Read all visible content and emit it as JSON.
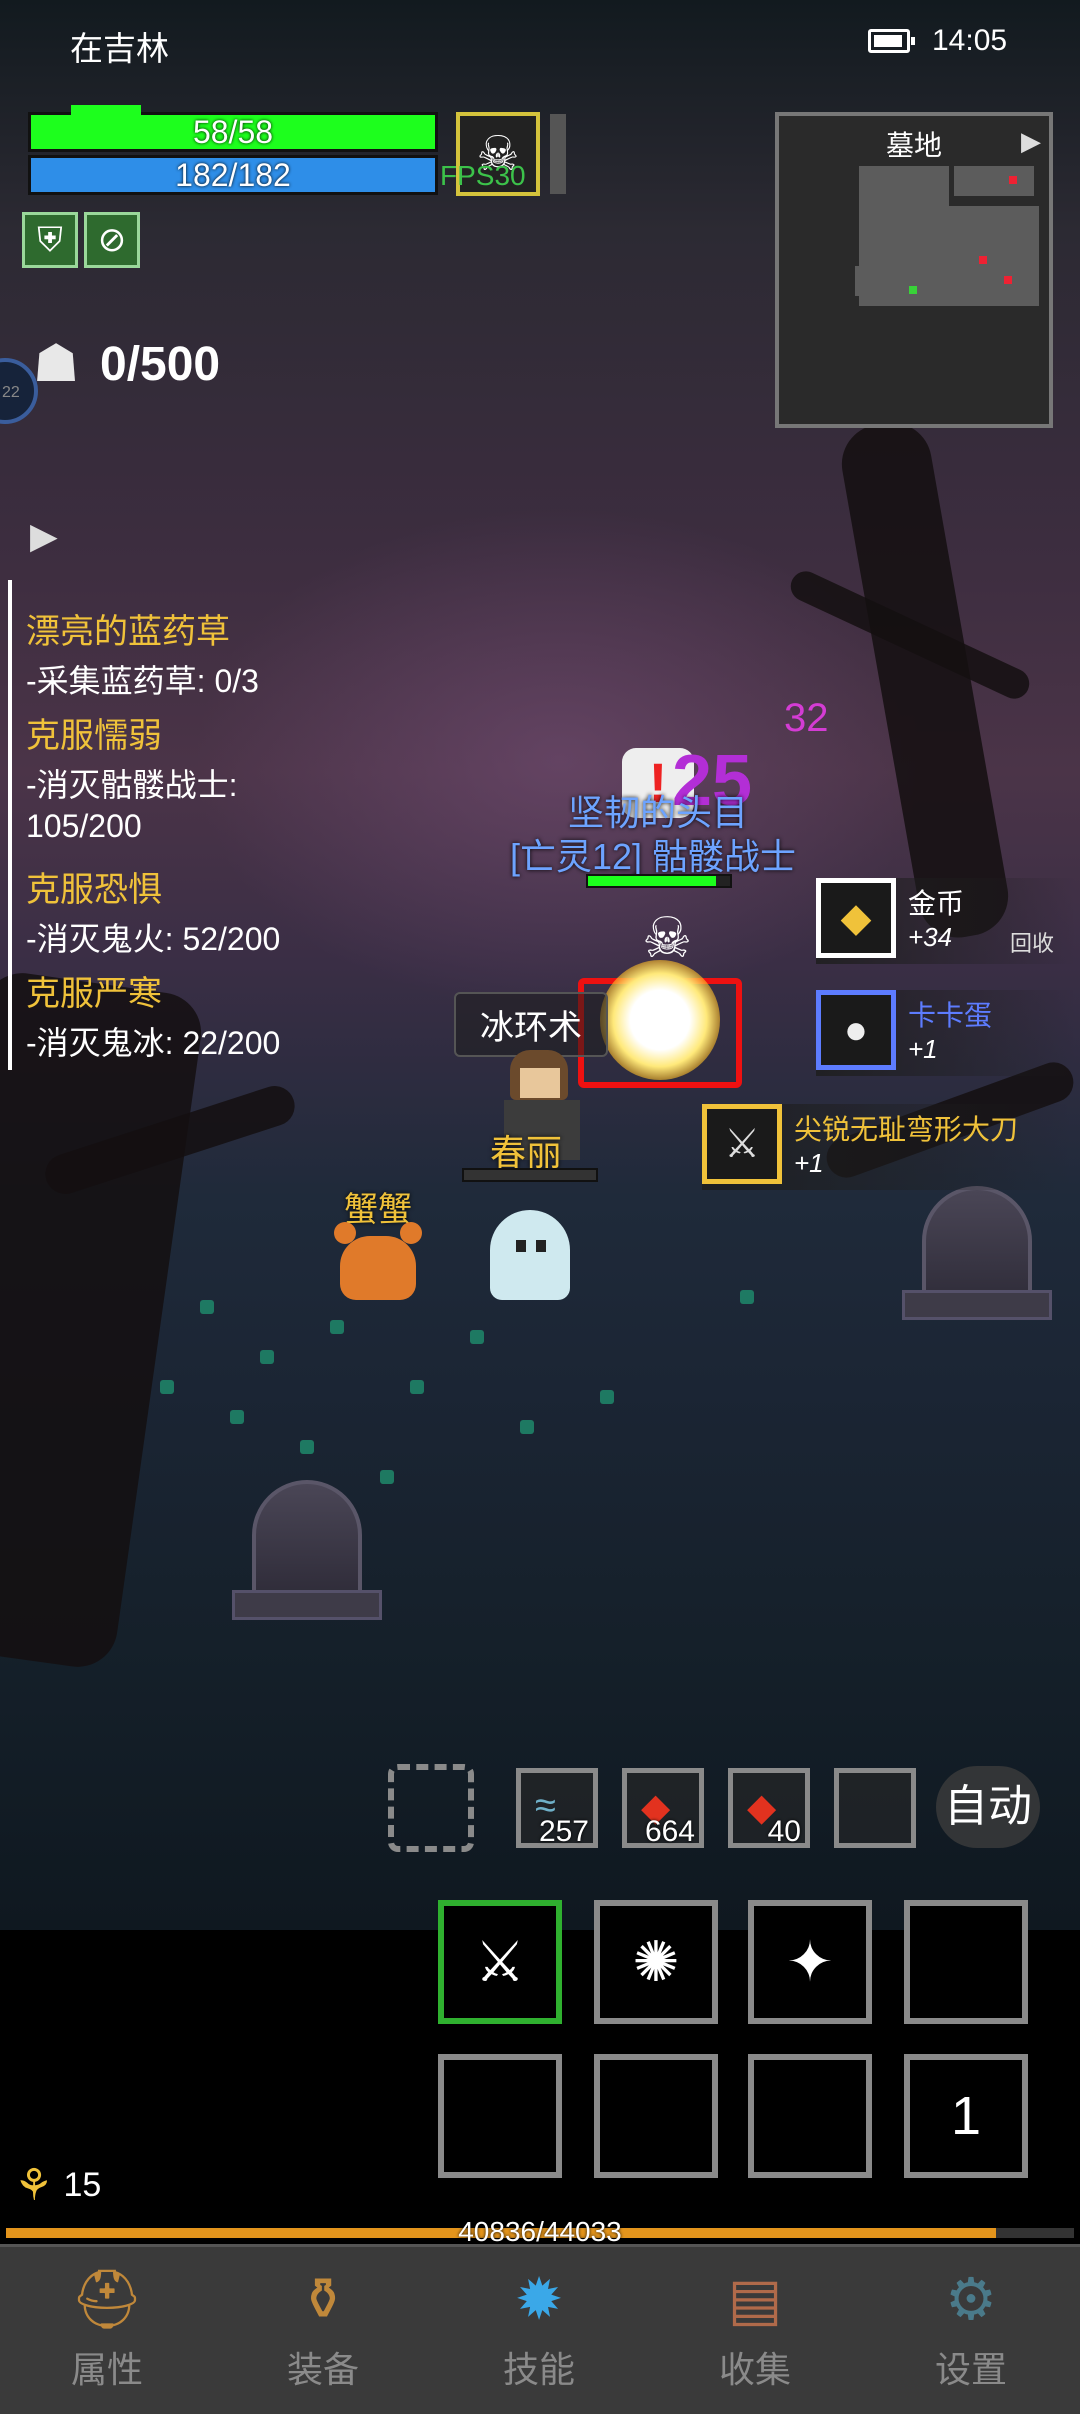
{
  "status": {
    "location": "在吉林",
    "time": "14:05"
  },
  "player_bars": {
    "hp": "58/58",
    "mp": "182/182",
    "fps": "FPS30"
  },
  "kills": {
    "count": "0/500"
  },
  "minimap": {
    "title": "墓地"
  },
  "quests": [
    {
      "title": "漂亮的蓝药草",
      "lines": [
        "-采集蓝药草: 0/3"
      ]
    },
    {
      "title": "克服懦弱",
      "lines": [
        "-消灭骷髅战士:",
        "105/200"
      ]
    },
    {
      "title": "克服恐惧",
      "lines": [
        "-消灭鬼火: 52/200"
      ]
    },
    {
      "title": "克服严寒",
      "lines": [
        "-消灭鬼冰: 22/200"
      ]
    }
  ],
  "world": {
    "damage_small": "32",
    "damage_big": "25",
    "enemy_title": "坚韧的头目",
    "enemy_name": "[亡灵12] 骷髅战士",
    "spell": "冰环术",
    "player_name": "春丽",
    "pet_name": "蟹蟹"
  },
  "loot": [
    {
      "name": "金币",
      "qty": "+34",
      "extra": "回收",
      "name_color": "#ffffff",
      "border": "#ffffff",
      "icon": "coins-icon",
      "glyph": "◆"
    },
    {
      "name": "卡卡蛋",
      "qty": "+1",
      "extra": "",
      "name_color": "#5d7cff",
      "border": "#5d7cff",
      "icon": "egg-icon",
      "glyph": "●"
    },
    {
      "name": "尖锐无耻弯形大刀",
      "qty": "+1",
      "extra": "",
      "name_color": "#f0c23a",
      "border": "#f0c23a",
      "icon": "sword-icon",
      "glyph": "⚔"
    }
  ],
  "quick_items": [
    {
      "count": "257",
      "icon": "fish-icon"
    },
    {
      "count": "664",
      "icon": "meat-icon"
    },
    {
      "count": "40",
      "icon": "meat-icon"
    },
    {
      "count": "",
      "icon": ""
    }
  ],
  "auto_label": "自动",
  "skills_page": "1",
  "level": "15",
  "xp": {
    "text": "40836/44033",
    "fraction": 0.927
  },
  "nav": [
    {
      "label": "属性",
      "icon": "helmet-icon"
    },
    {
      "label": "装备",
      "icon": "bag-icon"
    },
    {
      "label": "技能",
      "icon": "gem-icon"
    },
    {
      "label": "收集",
      "icon": "book-icon"
    },
    {
      "label": "设置",
      "icon": "gear-icon"
    }
  ],
  "colors": {
    "hp": "#1dff1d",
    "mp": "#2e8ee8",
    "quest_title": "#f0c23a",
    "xp": "#e3941c",
    "enemy_name": "#6da3ff"
  }
}
